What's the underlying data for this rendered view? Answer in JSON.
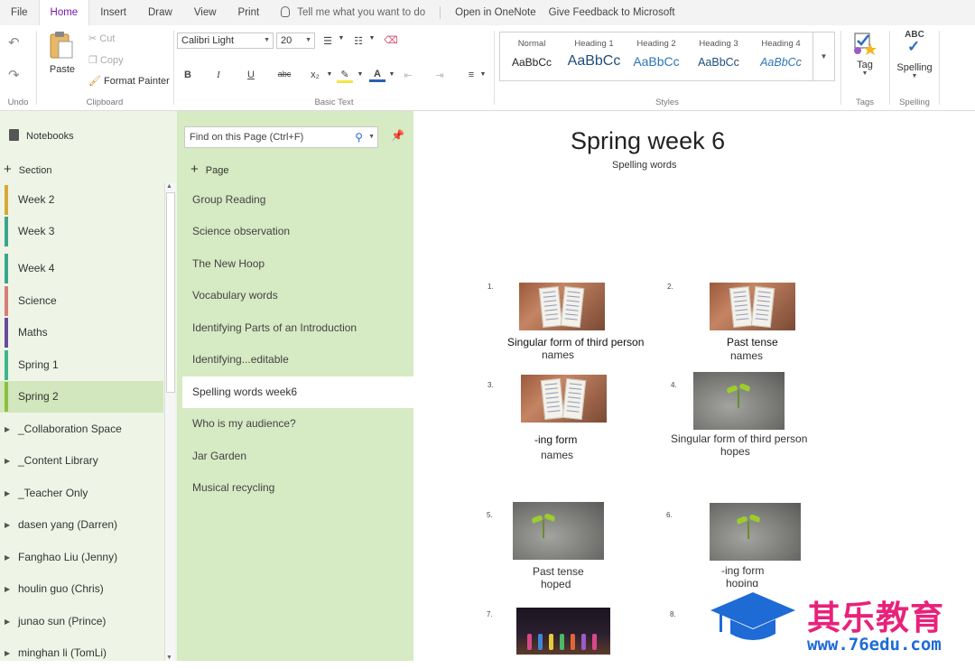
{
  "menu": {
    "tabs": [
      "File",
      "Home",
      "Insert",
      "Draw",
      "View",
      "Print"
    ],
    "tell_me": "Tell me what you want to do",
    "open_in_onenote": "Open in OneNote",
    "feedback": "Give Feedback to Microsoft"
  },
  "ribbon": {
    "undo_label": "Undo",
    "clipboard": {
      "paste": "Paste",
      "cut": "Cut",
      "copy": "Copy",
      "format_painter": "Format Painter",
      "label": "Clipboard"
    },
    "basic_text": {
      "font": "Calibri Light",
      "size": "20",
      "label": "Basic Text",
      "bold": "B",
      "italic": "I",
      "underline": "U",
      "strike": "abc",
      "subscript": "x₂"
    },
    "styles": {
      "label": "Styles",
      "items": [
        {
          "name": "Normal",
          "sample": "AaBbCc",
          "color": "#222222"
        },
        {
          "name": "Heading 1",
          "sample": "AaBbCc",
          "color": "#1f4e79"
        },
        {
          "name": "Heading 2",
          "sample": "AaBbCc",
          "color": "#2e75b6"
        },
        {
          "name": "Heading 3",
          "sample": "AaBbCc",
          "color": "#1f4e79"
        },
        {
          "name": "Heading 4",
          "sample": "AaBbCc",
          "color": "#2e75b6"
        }
      ]
    },
    "tags": {
      "button": "Tag",
      "label": "Tags"
    },
    "spelling": {
      "button": "Spelling",
      "icon_text": "ABC",
      "label": "Spelling"
    }
  },
  "sections": {
    "notebooks": "Notebooks",
    "add_section": "Section",
    "items": [
      {
        "label": "Week 2",
        "color": "#d8a838"
      },
      {
        "label": "Week 3",
        "color": "#3aa68a"
      },
      {
        "label": "Week 4",
        "color": "#3aa68a"
      },
      {
        "label": "Science",
        "color": "#d97d76"
      },
      {
        "label": "Maths",
        "color": "#6a4a9e"
      },
      {
        "label": "Spring 1",
        "color": "#3fb58c"
      },
      {
        "label": "Spring 2",
        "color": "#8cbf3f"
      }
    ],
    "groups": [
      "_Collaboration Space",
      "_Content Library",
      "_Teacher Only",
      "dasen yang (Darren)",
      "Fanghao Liu (Jenny)",
      "houlin guo (Chris)",
      "junao sun (Prince)",
      "minghan li (TomLi)"
    ]
  },
  "pages": {
    "search_placeholder": "Find on this Page (Ctrl+F)",
    "add_page": "Page",
    "items": [
      "Group Reading",
      "Science observation",
      "The New Hoop",
      "Vocabulary words",
      "Identifying Parts of an Introduction",
      "Identifying...editable",
      "Spelling words week6",
      "Who is my audience?",
      "Jar Garden",
      "Musical recycling"
    ],
    "active_index": 6
  },
  "canvas": {
    "title": "Spring week 6",
    "subtitle": "Spelling words",
    "items": [
      {
        "num": "1.",
        "line1": "Singular form of third person",
        "line2": "names",
        "image": "book"
      },
      {
        "num": "2.",
        "line1": "Past tense",
        "line2": "names",
        "image": "book"
      },
      {
        "num": "3.",
        "line1": "-ing form",
        "line2": "names",
        "image": "book"
      },
      {
        "num": "4.",
        "line1": "Singular form of third person",
        "line2": "hopes",
        "image": "sprout"
      },
      {
        "num": "5.",
        "line1": "Past tense",
        "line2": "hoped",
        "image": "sprout"
      },
      {
        "num": "6.",
        "line1": "-ing form",
        "line2": "hoping",
        "image": "sprout"
      },
      {
        "num": "7.",
        "line1": "",
        "line2": "",
        "image": "dancers"
      },
      {
        "num": "8.",
        "line1": "",
        "line2": "",
        "image": ""
      }
    ]
  },
  "watermark": {
    "text": "其乐教育",
    "url": "www.76edu.com"
  }
}
